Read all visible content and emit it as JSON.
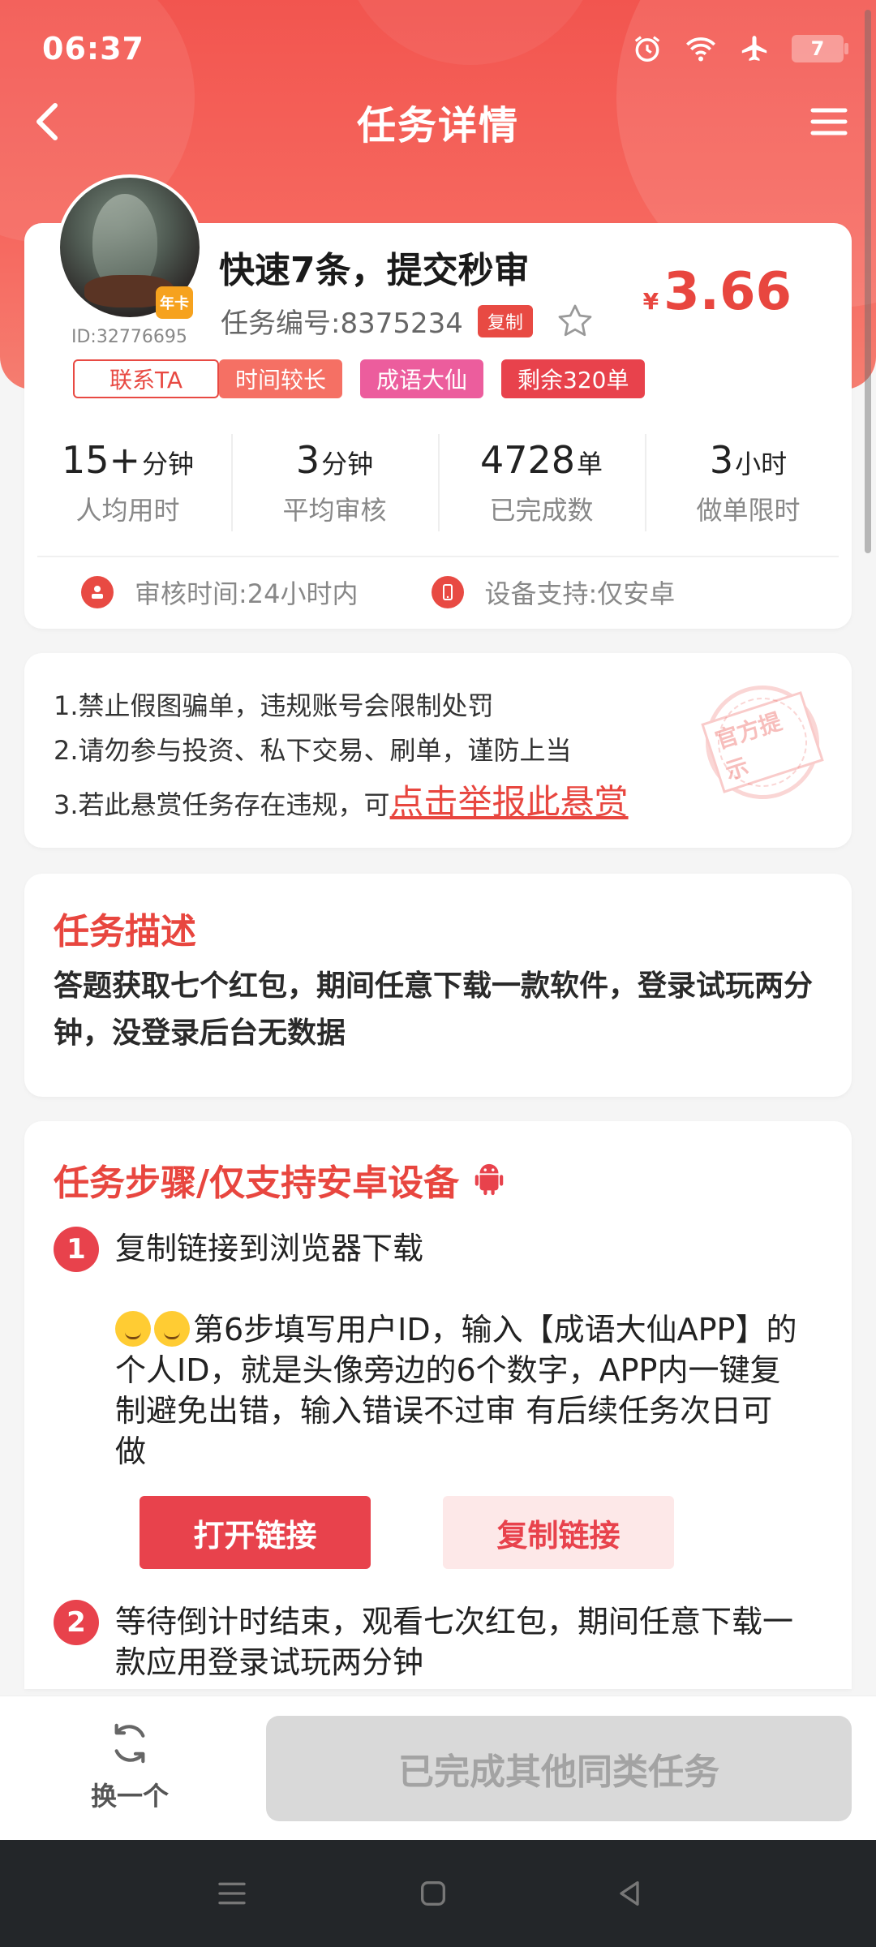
{
  "status_bar": {
    "time": "06:37",
    "battery": "7",
    "icons": [
      "alarm-icon",
      "wifi-icon",
      "airplane-icon",
      "battery-icon"
    ]
  },
  "nav": {
    "title": "任务详情",
    "back_icon": "back-arrow-icon",
    "menu_icon": "menu-icon"
  },
  "task": {
    "title": "快速7条，提交秒审",
    "code": "任务编号:8375234",
    "copy_label": "复制",
    "price_currency": "¥",
    "price": "3.66",
    "user_id": "ID:32776695",
    "vip_badge": "年卡",
    "contact_label": "联系TA",
    "tags": [
      "时间较长",
      "成语大仙",
      "剩余320单"
    ]
  },
  "stats": [
    {
      "num": "15+",
      "unit": "分钟",
      "label": "人均用时"
    },
    {
      "num": "3",
      "unit": "分钟",
      "label": "平均审核"
    },
    {
      "num": "4728",
      "unit": "单",
      "label": "已完成数"
    },
    {
      "num": "3",
      "unit": "小时",
      "label": "做单限时"
    }
  ],
  "meta": {
    "review_time": "审核时间:24小时内",
    "device": "设备支持:仅安卓"
  },
  "notice": {
    "line1": "1.禁止假图骗单，违规账号会限制处罚",
    "line2": "2.请勿参与投资、私下交易、刷单，谨防上当",
    "line3_prefix": "3.若此悬赏任务存在违规，可",
    "report_link": "点击举报此悬赏",
    "stamp": "官方提示"
  },
  "description": {
    "title": "任务描述",
    "text": "答题获取七个红包，期间任意下载一款软件，登录试玩两分钟，没登录后台无数据"
  },
  "steps": {
    "title": "任务步骤/仅支持安卓设备",
    "step1_num": "1",
    "step1_text": "复制链接到浏览器下载",
    "step1_note": "第6步填写用户ID，输入【成语大仙APP】的个人ID，就是头像旁边的6个数字，APP内一键复制避免出错，输入错误不过审 有后续任务次日可做",
    "open_link": "打开链接",
    "copy_link": "复制链接",
    "step2_num": "2",
    "step2_text": "等待倒计时结束，观看七次红包，期间任意下载一款应用登录试玩两分钟"
  },
  "bottom": {
    "switch_label": "换一个",
    "done_label": "已完成其他同类任务"
  },
  "colors": {
    "accent": "#e8463f",
    "header": "#f2554f",
    "disabled": "#d9d9d9"
  }
}
